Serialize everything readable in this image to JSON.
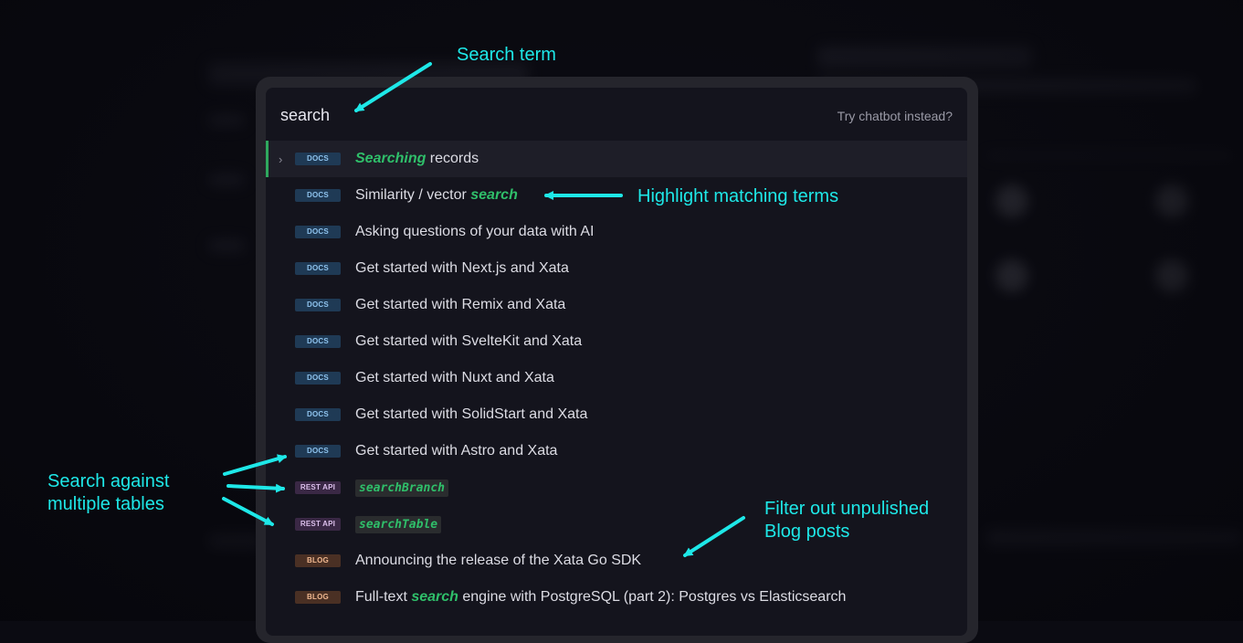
{
  "search": {
    "value": "search",
    "chatbot_label": "Try chatbot instead?"
  },
  "results": [
    {
      "badge": "DOCS",
      "kind": "docs",
      "title_parts": [
        {
          "t": "Searching",
          "h": true
        },
        {
          "t": " records",
          "h": false
        }
      ],
      "active": true
    },
    {
      "badge": "DOCS",
      "kind": "docs",
      "title_parts": [
        {
          "t": "Similarity / vector ",
          "h": false
        },
        {
          "t": "search",
          "h": true
        }
      ]
    },
    {
      "badge": "DOCS",
      "kind": "docs",
      "title_parts": [
        {
          "t": "Asking questions of your data with AI",
          "h": false
        }
      ]
    },
    {
      "badge": "DOCS",
      "kind": "docs",
      "title_parts": [
        {
          "t": "Get started with Next.js and Xata",
          "h": false
        }
      ]
    },
    {
      "badge": "DOCS",
      "kind": "docs",
      "title_parts": [
        {
          "t": "Get started with Remix and Xata",
          "h": false
        }
      ]
    },
    {
      "badge": "DOCS",
      "kind": "docs",
      "title_parts": [
        {
          "t": "Get started with SvelteKit and Xata",
          "h": false
        }
      ]
    },
    {
      "badge": "DOCS",
      "kind": "docs",
      "title_parts": [
        {
          "t": "Get started with Nuxt and Xata",
          "h": false
        }
      ]
    },
    {
      "badge": "DOCS",
      "kind": "docs",
      "title_parts": [
        {
          "t": "Get started with SolidStart and Xata",
          "h": false
        }
      ]
    },
    {
      "badge": "DOCS",
      "kind": "docs",
      "title_parts": [
        {
          "t": "Get started with Astro and Xata",
          "h": false
        }
      ]
    },
    {
      "badge": "REST API",
      "kind": "rest",
      "title_parts": [
        {
          "t": "searchBranch",
          "h": true,
          "code": true
        }
      ]
    },
    {
      "badge": "REST API",
      "kind": "rest",
      "title_parts": [
        {
          "t": "searchTable",
          "h": true,
          "code": true
        }
      ]
    },
    {
      "badge": "BLOG",
      "kind": "blog",
      "title_parts": [
        {
          "t": "Announcing the release of the Xata Go SDK",
          "h": false
        }
      ]
    },
    {
      "badge": "BLOG",
      "kind": "blog",
      "title_parts": [
        {
          "t": "Full-text ",
          "h": false
        },
        {
          "t": "search",
          "h": true
        },
        {
          "t": " engine with PostgreSQL (part 2): Postgres vs Elasticsearch",
          "h": false
        }
      ]
    }
  ],
  "annotations": {
    "search_term": "Search term",
    "highlight": "Highlight matching terms",
    "multiple_tables": "Search against\nmultiple tables",
    "filter_blog": "Filter out unpulished\nBlog posts"
  },
  "colors": {
    "accent_green": "#2fbf6a",
    "annotation_cyan": "#1ee8e8"
  },
  "icons": {
    "row_chevron": "chevron-right-icon"
  }
}
